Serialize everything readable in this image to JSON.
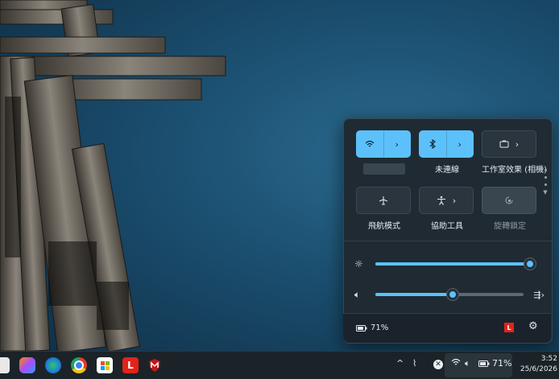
{
  "quick_settings": {
    "tiles": [
      {
        "id": "wifi",
        "label": "",
        "state": "on",
        "has_arrow": true
      },
      {
        "id": "bluetooth",
        "label": "未連線",
        "state": "on",
        "has_arrow": true
      },
      {
        "id": "studio-effects",
        "label": "工作室效果 (相機)",
        "state": "off",
        "has_arrow": true
      },
      {
        "id": "airplane",
        "label": "飛航模式",
        "state": "off",
        "has_arrow": false
      },
      {
        "id": "accessibility",
        "label": "協助工具",
        "state": "off",
        "has_arrow": true
      },
      {
        "id": "rotation-lock",
        "label": "旋轉鎖定",
        "state": "disabled",
        "has_arrow": false
      }
    ],
    "brightness": {
      "level": 0.98
    },
    "volume": {
      "level": 0.52
    },
    "battery_label": "71%",
    "accent_color": "#5cc1fb"
  },
  "taskbar": {
    "battery_label": "71%",
    "time": "3:52",
    "date": "25/6/2026",
    "icons": [
      "file-explorer-icon",
      "copilot-icon",
      "edge-icon",
      "chrome-icon",
      "store-icon",
      "lenovo-icon",
      "mcafee-icon"
    ]
  }
}
